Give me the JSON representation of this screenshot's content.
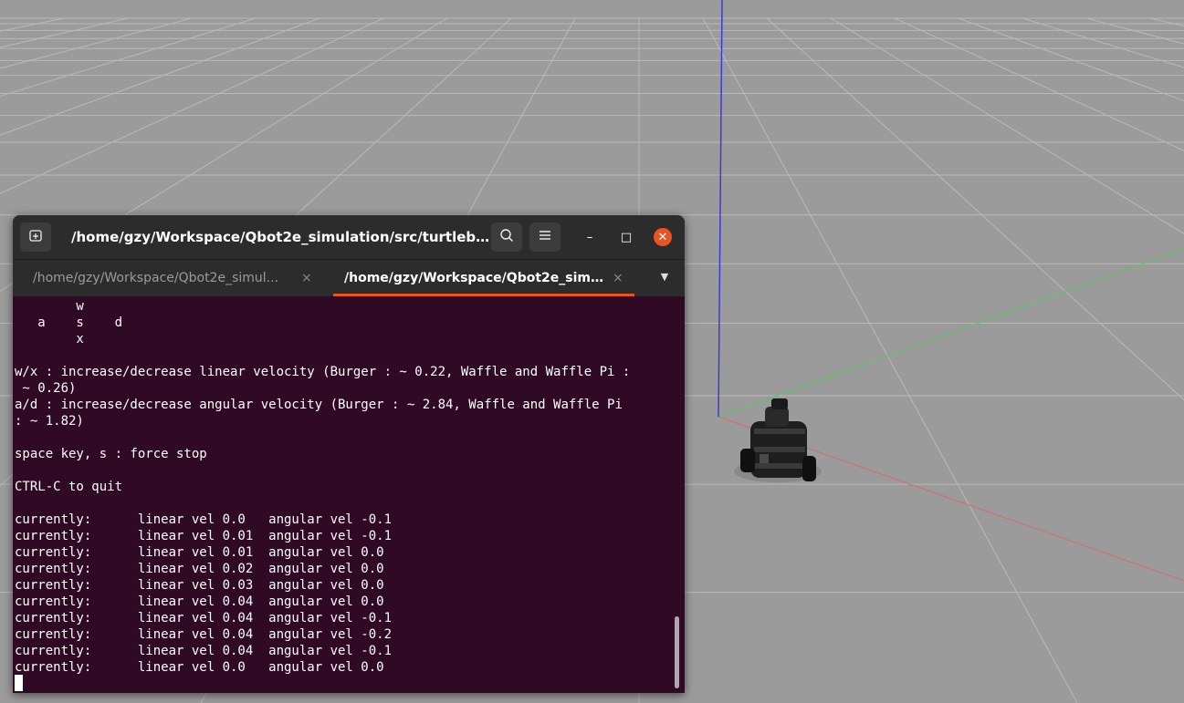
{
  "scene": {
    "name": "gazebo-3d-view",
    "robot": "turtlebot3 waffle pi"
  },
  "terminal": {
    "title": "/home/gzy/Workspace/Qbot2e_simulation/src/turtlebot3_t...",
    "new_tab_icon": "new-tab-icon",
    "search_icon": "search-icon",
    "menu_icon": "hamburger-menu-icon",
    "minimize_label": "–",
    "maximize_label": "□",
    "close_label": "✕",
    "tabs": [
      {
        "label": "/home/gzy/Workspace/Qbot2e_simul...",
        "active": false
      },
      {
        "label": "/home/gzy/Workspace/Qbot2e_simul...",
        "active": true
      }
    ],
    "tab_close_label": "×",
    "tab_menu_label": "▼",
    "lines": [
      "        w",
      "   a    s    d",
      "        x",
      "",
      "w/x : increase/decrease linear velocity (Burger : ~ 0.22, Waffle and Waffle Pi :",
      " ~ 0.26)",
      "a/d : increase/decrease angular velocity (Burger : ~ 2.84, Waffle and Waffle Pi",
      ": ~ 1.82)",
      "",
      "space key, s : force stop",
      "",
      "CTRL-C to quit",
      "",
      "currently:      linear vel 0.0   angular vel -0.1",
      "currently:      linear vel 0.01  angular vel -0.1",
      "currently:      linear vel 0.01  angular vel 0.0",
      "currently:      linear vel 0.02  angular vel 0.0",
      "currently:      linear vel 0.03  angular vel 0.0",
      "currently:      linear vel 0.04  angular vel 0.0",
      "currently:      linear vel 0.04  angular vel -0.1",
      "currently:      linear vel 0.04  angular vel -0.2",
      "currently:      linear vel 0.04  angular vel -0.1",
      "currently:      linear vel 0.0   angular vel 0.0"
    ]
  },
  "colors": {
    "terminal_bg": "#300a24",
    "accent": "#e95420",
    "scene_bg": "#9a9a9a"
  }
}
